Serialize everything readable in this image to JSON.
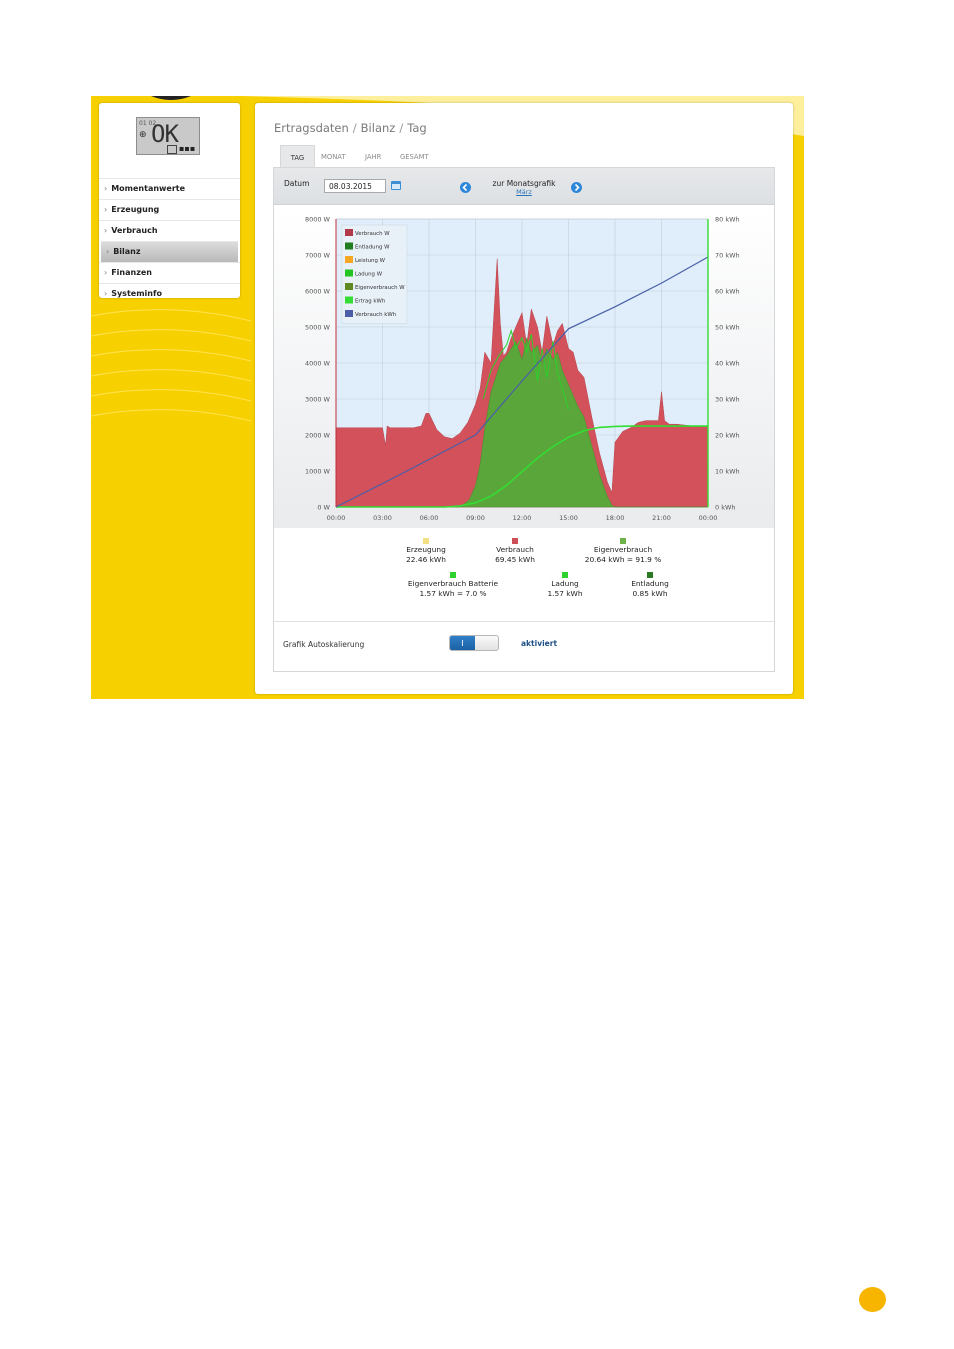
{
  "sidebar": {
    "display": {
      "text": "OK",
      "mini_text": "01\n02"
    },
    "items": [
      {
        "label": "Momentanwerte",
        "active": false
      },
      {
        "label": "Erzeugung",
        "active": false
      },
      {
        "label": "Verbrauch",
        "active": false
      },
      {
        "label": "Bilanz",
        "active": true
      },
      {
        "label": "Finanzen",
        "active": false
      },
      {
        "label": "Systeminfo",
        "active": false
      }
    ],
    "chevron": "›"
  },
  "breadcrumb": {
    "part1": "Ertragsdaten",
    "part2": "Bilanz",
    "part3": "Tag",
    "separator": "/"
  },
  "tabs": [
    {
      "label": "TAG",
      "active": true
    },
    {
      "label": "MONAT",
      "active": false
    },
    {
      "label": "JAHR",
      "active": false
    },
    {
      "label": "GESAMT",
      "active": false
    }
  ],
  "date_row": {
    "label": "Datum",
    "value": "08.03.2015",
    "month_link_title": "zur Monatsgrafik",
    "month_link_sub": "März",
    "icons": [
      "calendar-icon",
      "prev-arrow-icon",
      "next-arrow-icon"
    ]
  },
  "chart_data": {
    "type": "area",
    "x_ticks": [
      "00:00",
      "03:00",
      "06:00",
      "09:00",
      "12:00",
      "15:00",
      "18:00",
      "21:00",
      "00:00"
    ],
    "y_left_ticks": [
      "0 W",
      "1000 W",
      "2000 W",
      "3000 W",
      "4000 W",
      "5000 W",
      "6000 W",
      "7000 W",
      "8000 W"
    ],
    "y_right_ticks": [
      "0 kWh",
      "10 kWh",
      "20 kWh",
      "30 kWh",
      "40 kWh",
      "50 kWh",
      "60 kWh",
      "70 kWh",
      "80 kWh"
    ],
    "ylim_left": [
      0,
      8000
    ],
    "ylim_right": [
      0,
      80
    ],
    "xlim_hours": [
      0,
      24
    ],
    "legend_placement": "top-left",
    "legend": [
      {
        "name": "Verbrauch W",
        "color": "#b03a48"
      },
      {
        "name": "Entladung W",
        "color": "#1e7d1e"
      },
      {
        "name": "Leistung W",
        "color": "#f5a623"
      },
      {
        "name": "Ladung W",
        "color": "#22c422"
      },
      {
        "name": "Eigenverbrauch W",
        "color": "#5f8a23"
      },
      {
        "name": "Ertrag kWh",
        "color": "#33dd33"
      },
      {
        "name": "Verbrauch kWh",
        "color": "#4a5fa8"
      }
    ],
    "series": [
      {
        "name": "Verbrauch W",
        "color": "#d2515b",
        "x": [
          0,
          0.5,
          1,
          2,
          3,
          3.2,
          3.3,
          3.5,
          4,
          4.5,
          5,
          5.5,
          5.8,
          6,
          6.5,
          7,
          7.5,
          8,
          8.5,
          9,
          9.3,
          9.6,
          10,
          10.4,
          10.6,
          10.8,
          11,
          11.3,
          11.6,
          12,
          12.3,
          12.6,
          13,
          13.3,
          13.6,
          14,
          14.3,
          14.6,
          15,
          15.3,
          15.6,
          16,
          16.5,
          17,
          17.5,
          17.8,
          18,
          18.5,
          19,
          19.5,
          20,
          20.5,
          20.8,
          21,
          21.2,
          21.5,
          22,
          23,
          23.9,
          24
        ],
        "values": [
          2200,
          2200,
          2200,
          2200,
          2200,
          1700,
          2250,
          2200,
          2200,
          2200,
          2200,
          2250,
          2600,
          2600,
          2150,
          1950,
          1900,
          2050,
          2350,
          2850,
          3300,
          4300,
          4000,
          6900,
          5100,
          4200,
          4300,
          4700,
          5000,
          5400,
          4500,
          5500,
          5000,
          4300,
          5300,
          4500,
          4900,
          5100,
          4400,
          4300,
          3800,
          3600,
          2500,
          1500,
          700,
          400,
          1800,
          2100,
          2200,
          2350,
          2400,
          2400,
          2400,
          3200,
          2400,
          2300,
          2300,
          2250,
          2250,
          2250
        ]
      },
      {
        "name": "Eigenverbrauch W",
        "color": "#5aa63a",
        "x": [
          0,
          8,
          8.6,
          9,
          9.3,
          9.6,
          10,
          10.3,
          10.6,
          11,
          11.3,
          11.6,
          12,
          12.3,
          12.6,
          13,
          13.3,
          13.6,
          14,
          14.3,
          14.6,
          15,
          15.3,
          15.6,
          16,
          16.5,
          17,
          17.5,
          17.8,
          18,
          24
        ],
        "values": [
          0,
          0,
          200,
          600,
          1200,
          2200,
          3200,
          3600,
          4000,
          4200,
          4400,
          4600,
          4100,
          4700,
          4300,
          4500,
          4000,
          4400,
          4100,
          4300,
          3800,
          3400,
          3100,
          2800,
          2500,
          1700,
          900,
          300,
          50,
          0,
          0
        ]
      },
      {
        "name": "Ladung W",
        "color": "#2bd12b",
        "x": [
          9.5,
          10,
          10.5,
          11,
          11.3,
          11.6,
          12,
          12.3,
          12.6,
          13,
          13.3,
          13.6,
          14,
          14.3,
          14.6,
          15
        ],
        "values": [
          3000,
          3800,
          4200,
          4500,
          4900,
          4400,
          4700,
          4300,
          4800,
          3500,
          4400,
          3600,
          4600,
          3700,
          3300,
          2700
        ]
      },
      {
        "name": "Ertrag kWh",
        "color": "#33dd33",
        "x": [
          0,
          7,
          8,
          9,
          10,
          11,
          12,
          13,
          14,
          15,
          16,
          17,
          18,
          19,
          20,
          21,
          22,
          23,
          24
        ],
        "values": [
          0,
          0,
          0.3,
          1.2,
          3.0,
          6.0,
          9.8,
          13.6,
          16.8,
          19.4,
          21.2,
          22.1,
          22.4,
          22.46,
          22.46,
          22.46,
          22.46,
          22.46,
          22.46
        ]
      },
      {
        "name": "Verbrauch kWh",
        "color": "#4a5fa8",
        "x": [
          0,
          3,
          6,
          9,
          12,
          15,
          18,
          21,
          24
        ],
        "values": [
          0,
          6.5,
          13.2,
          20.0,
          35.0,
          49.5,
          55.6,
          62.2,
          69.45
        ]
      }
    ]
  },
  "summary": [
    {
      "label": "Erzeugung",
      "value": "22.46 kWh",
      "color": "#f2e082"
    },
    {
      "label": "Verbrauch",
      "value": "69.45 kWh",
      "color": "#cf4f57"
    },
    {
      "label": "Eigenverbrauch",
      "value": "20.64 kWh = 91.9 %",
      "color": "#6eb34a"
    },
    {
      "label": "Eigenverbrauch Batterie",
      "value": "1.57 kWh = 7.0 %",
      "color": "#2ed12e"
    },
    {
      "label": "Ladung",
      "value": "1.57 kWh",
      "color": "#2ed12e"
    },
    {
      "label": "Entladung",
      "value": "0.85 kWh",
      "color": "#2a7a23"
    }
  ],
  "autoscale": {
    "label": "Grafik Autoskalierung",
    "toggle_on_text": "I",
    "state_text": "aktiviert",
    "enabled": true
  }
}
